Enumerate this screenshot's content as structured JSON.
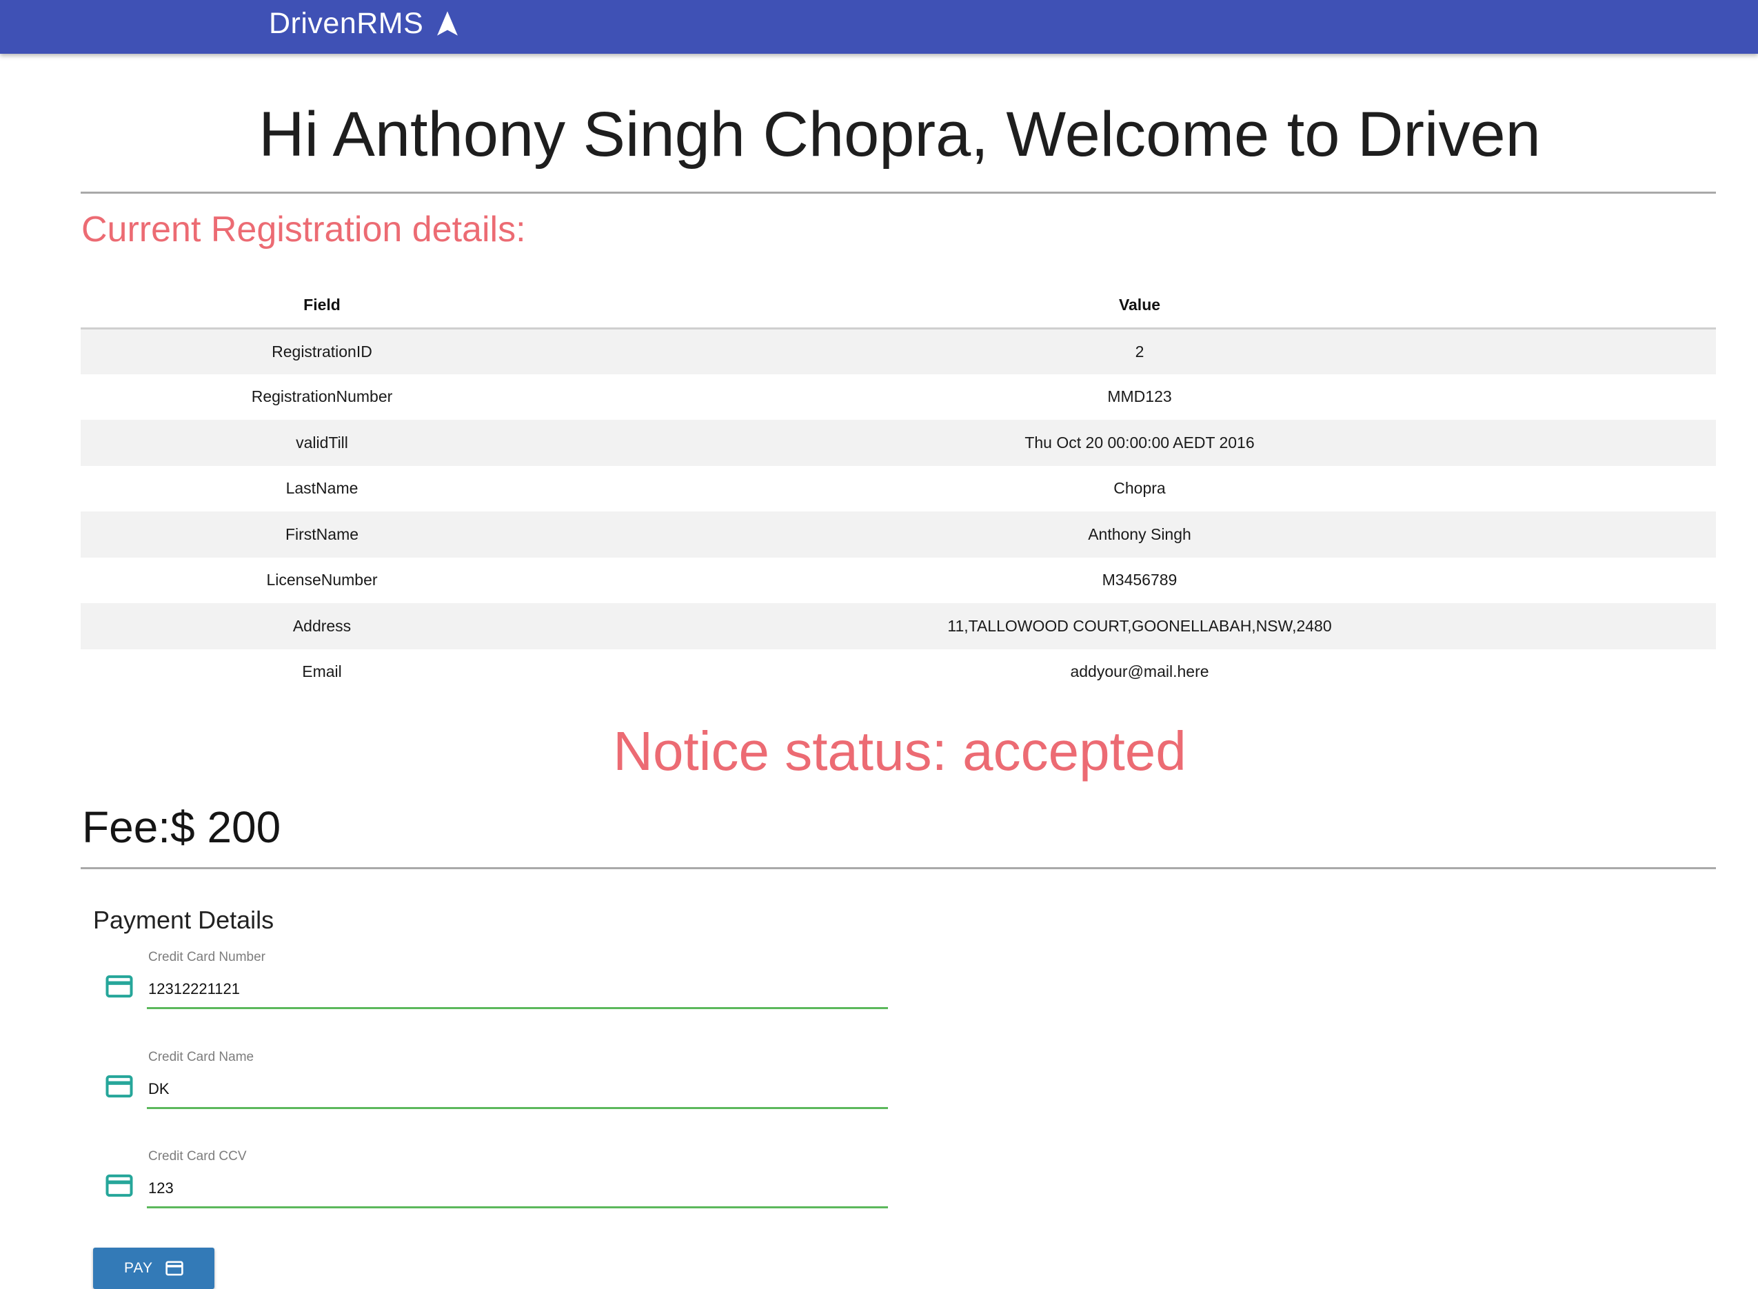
{
  "appbar": {
    "brand": "DrivenRMS",
    "brand_icon": "navigation-arrow-icon",
    "color": "#3f51b5"
  },
  "welcome": {
    "heading": "Hi Anthony Singh Chopra, Welcome to Driven"
  },
  "registration": {
    "section_title": "Current Registration details:",
    "columns": [
      "Field",
      "Value"
    ],
    "rows": [
      {
        "field": "RegistrationID",
        "value": "2"
      },
      {
        "field": "RegistrationNumber",
        "value": "MMD123"
      },
      {
        "field": "validTill",
        "value": "Thu Oct 20 00:00:00 AEDT 2016"
      },
      {
        "field": "LastName",
        "value": "Chopra"
      },
      {
        "field": "FirstName",
        "value": "Anthony Singh"
      },
      {
        "field": "LicenseNumber",
        "value": "M3456789"
      },
      {
        "field": "Address",
        "value": "11,TALLOWOOD COURT,GOONELLABAH,NSW,2480"
      },
      {
        "field": "Email",
        "value": "addyour@mail.here"
      }
    ]
  },
  "notice": {
    "status_text": "Notice status: accepted",
    "color": "#ec6b73"
  },
  "fee": {
    "label": "Fee:$ 200"
  },
  "payment": {
    "title": "Payment Details",
    "fields": [
      {
        "label": "Credit Card Number",
        "value": "12312221121",
        "icon": "credit-card-icon"
      },
      {
        "label": "Credit Card Name",
        "value": "DK",
        "icon": "credit-card-icon"
      },
      {
        "label": "Credit Card CCV",
        "value": "123",
        "icon": "credit-card-icon"
      }
    ],
    "field_underline_color": "#5cb85c",
    "icon_color": "#26a69a",
    "pay_button": {
      "label": "PAY",
      "icon": "credit-card-icon",
      "color": "#337ab7"
    }
  }
}
